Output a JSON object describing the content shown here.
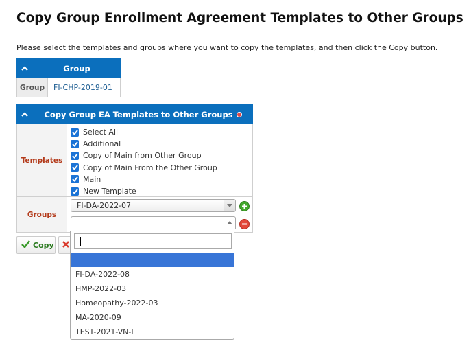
{
  "page": {
    "title": "Copy Group Enrollment Agreement Templates to Other Groups",
    "instructions": "Please select the templates and groups where you want to copy the templates, and then click the Copy button."
  },
  "group_panel": {
    "header": "Group",
    "row_label": "Group",
    "row_value": "FI-CHP-2019-01"
  },
  "copy_panel": {
    "header": "Copy Group EA Templates to Other Groups",
    "templates_label": "Templates",
    "templates": [
      {
        "label": "Select All",
        "checked": true
      },
      {
        "label": "Additional",
        "checked": true
      },
      {
        "label": "Copy of Main from Other Group",
        "checked": true
      },
      {
        "label": "Copy of Main From the Other Group",
        "checked": true
      },
      {
        "label": "Main",
        "checked": true
      },
      {
        "label": "New Template",
        "checked": true
      }
    ],
    "groups_label": "Groups",
    "group_select_1": "FI-DA-2022-07",
    "group_select_2": ""
  },
  "actions": {
    "copy_label": "Copy"
  },
  "dropdown": {
    "search_value": "",
    "options": [
      "",
      "FI-DA-2022-08",
      "HMP-2022-03",
      "Homeopathy-2022-03",
      "MA-2020-09",
      "TEST-2021-VN-I"
    ],
    "highlighted_index": 0
  },
  "colors": {
    "header_bg": "#0b6fbd",
    "label_red": "#b33a1a",
    "checkbox": "#1a73d6",
    "highlight": "#3875d7",
    "add_green": "#43a82c",
    "remove_red": "#e3483a"
  }
}
